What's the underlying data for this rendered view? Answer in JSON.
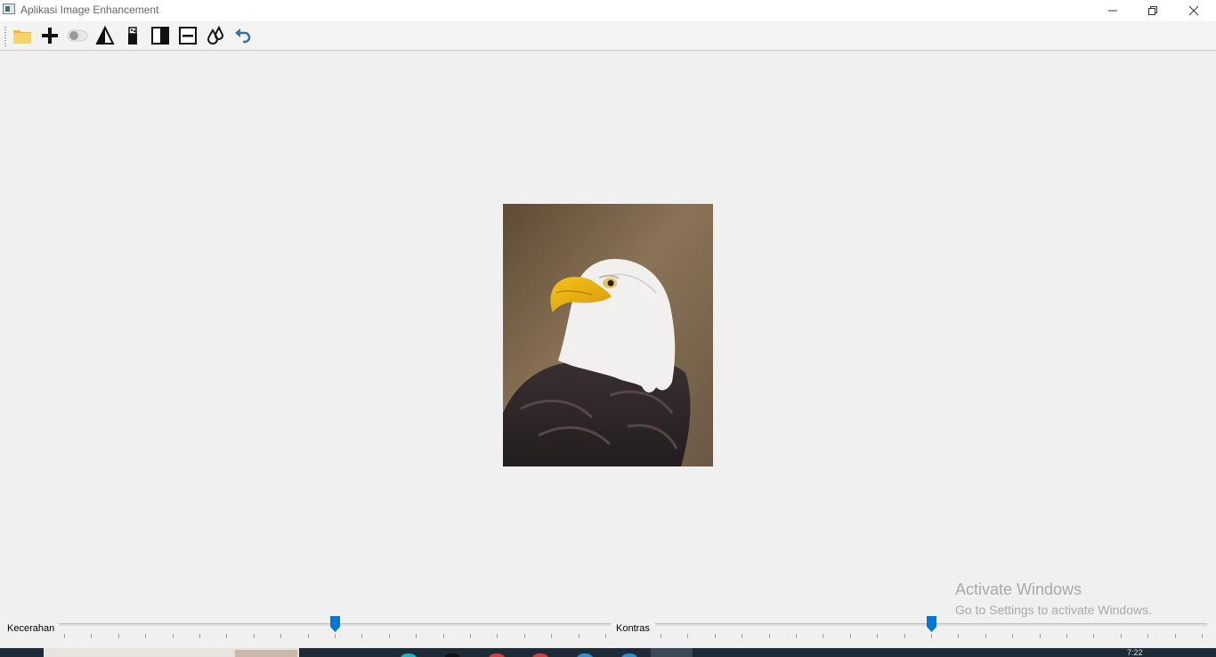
{
  "window": {
    "title": "Aplikasi Image Enhancement",
    "controls": [
      "minimize-icon",
      "restore-icon",
      "close-icon"
    ]
  },
  "toolbar": {
    "buttons": [
      {
        "name": "open-file-button",
        "icon": "folder-icon"
      },
      {
        "name": "add-button",
        "icon": "plus-icon"
      },
      {
        "name": "toggle-button",
        "icon": "toggle-switch-icon"
      },
      {
        "name": "triangle-button",
        "icon": "triangle-icon"
      },
      {
        "name": "noise-button",
        "icon": "bottle-icon"
      },
      {
        "name": "half-contrast-button",
        "icon": "half-square-icon"
      },
      {
        "name": "subtract-button",
        "icon": "minus-box-icon"
      },
      {
        "name": "drops-button",
        "icon": "drops-icon"
      },
      {
        "name": "undo-button",
        "icon": "undo-arrow-icon"
      }
    ]
  },
  "image": {
    "subject": "bald-eagle-photo"
  },
  "sliders": {
    "brightness": {
      "label": "Kecerahan",
      "value_fraction": 0.5,
      "tick_count": 21
    },
    "contrast": {
      "label": "Kontras",
      "value_fraction": 0.5,
      "tick_count": 21
    }
  },
  "watermark": {
    "title": "Activate Windows",
    "subtitle": "Go to Settings to activate Windows."
  },
  "taskbar": {
    "clock": "7:22"
  },
  "colors": {
    "accent": "#0078d7",
    "background": "#f0f0f0"
  }
}
